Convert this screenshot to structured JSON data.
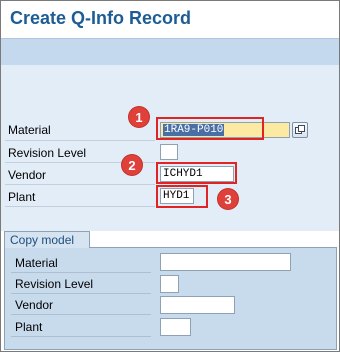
{
  "window": {
    "title": "Create Q-Info Record"
  },
  "main": {
    "fields": {
      "material": {
        "label": "Material",
        "value": "1RA9-P010"
      },
      "revision_level": {
        "label": "Revision Level",
        "value": ""
      },
      "vendor": {
        "label": "Vendor",
        "value": "ICHYD1"
      },
      "plant": {
        "label": "Plant",
        "value": "HYD1"
      }
    },
    "annotations": {
      "badge1": "1",
      "badge2": "2",
      "badge3": "3"
    }
  },
  "copy_model": {
    "title": "Copy model",
    "fields": {
      "material": {
        "label": "Material",
        "value": ""
      },
      "revision_level": {
        "label": "Revision Level",
        "value": ""
      },
      "vendor": {
        "label": "Vendor",
        "value": ""
      },
      "plant": {
        "label": "Plant",
        "value": ""
      }
    }
  },
  "icons": {
    "material_search": "f4-value-help-icon"
  },
  "colors": {
    "title": "#1d5d96",
    "toolbar": "#c5d9ee",
    "panel": "#e3edf7",
    "annotation_red": "#e02424"
  }
}
